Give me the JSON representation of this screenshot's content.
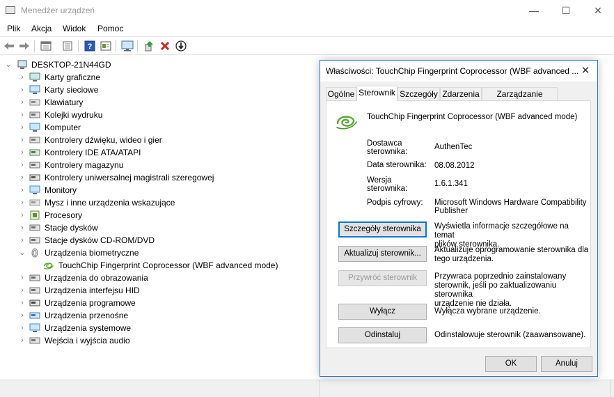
{
  "window": {
    "title": "Menedżer urządzeń",
    "minimize_glyph": "—",
    "maximize_glyph": "☐",
    "close_glyph": "✕"
  },
  "menu": [
    "Plik",
    "Akcja",
    "Widok",
    "Pomoc"
  ],
  "toolbar_icons": [
    "back-arrow-icon",
    "forward-arrow-icon",
    "properties-pane-icon",
    "list-view-icon",
    "help-icon",
    "details-view-icon",
    "monitor-scan-icon",
    "update-driver-icon",
    "uninstall-x-icon",
    "download-circle-icon"
  ],
  "tree": {
    "root": "DESKTOP-21N44GD",
    "items": [
      {
        "label": "Karty graficzne",
        "icon": "display-adapter-icon",
        "expanded": false
      },
      {
        "label": "Karty sieciowe",
        "icon": "network-adapter-icon",
        "expanded": false
      },
      {
        "label": "Klawiatury",
        "icon": "keyboard-icon",
        "expanded": false
      },
      {
        "label": "Kolejki wydruku",
        "icon": "printer-icon",
        "expanded": false
      },
      {
        "label": "Komputer",
        "icon": "computer-icon",
        "expanded": false
      },
      {
        "label": "Kontrolery dźwięku, wideo i gier",
        "icon": "speaker-icon",
        "expanded": false
      },
      {
        "label": "Kontrolery IDE ATA/ATAPI",
        "icon": "ide-controller-icon",
        "expanded": false
      },
      {
        "label": "Kontrolery magazynu",
        "icon": "storage-controller-icon",
        "expanded": false
      },
      {
        "label": "Kontrolery uniwersalnej magistrali szeregowej",
        "icon": "usb-icon",
        "expanded": false
      },
      {
        "label": "Monitory",
        "icon": "monitor-icon",
        "expanded": false
      },
      {
        "label": "Mysz i inne urządzenia wskazujące",
        "icon": "mouse-icon",
        "expanded": false
      },
      {
        "label": "Procesory",
        "icon": "cpu-icon",
        "expanded": false
      },
      {
        "label": "Stacje dysków",
        "icon": "disk-drive-icon",
        "expanded": false
      },
      {
        "label": "Stacje dysków CD-ROM/DVD",
        "icon": "dvd-drive-icon",
        "expanded": false
      },
      {
        "label": "Urządzenia biometryczne",
        "icon": "fingerprint-icon",
        "expanded": true
      },
      {
        "label": "TouchChip Fingerprint Coprocessor (WBF advanced mode)",
        "icon": "touchchip-icon",
        "child": true
      },
      {
        "label": "Urządzenia do obrazowania",
        "icon": "camera-icon",
        "expanded": false
      },
      {
        "label": "Urządzenia interfejsu HID",
        "icon": "hid-icon",
        "expanded": false
      },
      {
        "label": "Urządzenia programowe",
        "icon": "software-device-icon",
        "expanded": false
      },
      {
        "label": "Urządzenia przenośne",
        "icon": "portable-device-icon",
        "expanded": false
      },
      {
        "label": "Urządzenia systemowe",
        "icon": "system-device-icon",
        "expanded": false
      },
      {
        "label": "Wejścia i wyjścia audio",
        "icon": "audio-io-icon",
        "expanded": false
      }
    ]
  },
  "dialog": {
    "title": "Właściwości: TouchChip Fingerprint Coprocessor (WBF advanced ...",
    "close_glyph": "✕",
    "tabs": [
      "Ogólne",
      "Sterownik",
      "Szczegóły",
      "Zdarzenia",
      "Zarządzanie energią"
    ],
    "active_tab": "Sterownik",
    "device_name": "TouchChip Fingerprint Coprocessor (WBF advanced mode)",
    "fields": [
      {
        "label_lines": [
          "Dostawca",
          "sterownika:"
        ],
        "value": "AuthenTec"
      },
      {
        "label_lines": [
          "Data sterownika:"
        ],
        "value": "08.08.2012"
      },
      {
        "label_lines": [
          "Wersja",
          "sterownika:"
        ],
        "value": "1.6.1.341"
      },
      {
        "label_lines": [
          "Podpis cyfrowy:"
        ],
        "value_lines": [
          "Microsoft Windows Hardware Compatibility",
          "Publisher"
        ]
      }
    ],
    "actions": [
      {
        "button": "Szczegóły sterownika",
        "desc_lines": [
          "Wyświetla informacje szczegółowe na temat",
          "plików sterownika."
        ],
        "state": "focused"
      },
      {
        "button": "Aktualizuj sterownik...",
        "desc_lines": [
          "Aktualizuje oprogramowanie sterownika dla",
          "tego urządzenia."
        ],
        "state": "normal"
      },
      {
        "button": "Przywróć sterownik",
        "desc_lines": [
          "Przywraca poprzednio zainstalowany",
          "sterownik, jeśli po zaktualizowaniu sterownika",
          "urządzenie nie działa."
        ],
        "state": "disabled"
      },
      {
        "button": "Wyłącz",
        "desc_lines": [
          "Wyłącza wybrane urządzenie."
        ],
        "state": "normal"
      },
      {
        "button": "Odinstaluj",
        "desc_lines": [
          "Odinstalowuje sterownik (zaawansowane)."
        ],
        "state": "normal"
      }
    ],
    "ok": "OK",
    "cancel": "Anuluj"
  },
  "colors": {
    "accent": "#0078d7",
    "dialog_border": "#2b79d0"
  }
}
